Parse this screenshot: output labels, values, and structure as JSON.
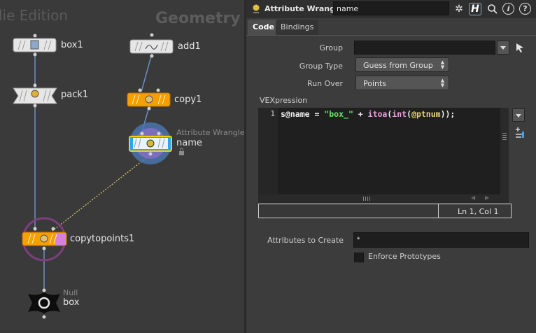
{
  "network": {
    "edition_watermark": "lie Edition",
    "context_title": "Geometry",
    "nodes": {
      "box1": {
        "label": "box1"
      },
      "add1": {
        "label": "add1"
      },
      "pack1": {
        "label": "pack1"
      },
      "copy1": {
        "label": "copy1"
      },
      "wrangle": {
        "type_label": "Attribute Wrangle",
        "label": "name"
      },
      "copytopoints1": {
        "label": "copytopoints1"
      },
      "null": {
        "type_label": "Null",
        "label": "box"
      }
    },
    "colors": {
      "bg": "#3a3a3a",
      "wire": "#6b8fc4",
      "selected_node": "#f5a000",
      "dotted_wire": "#d9d06a"
    }
  },
  "panel": {
    "header": {
      "node_type": "Attribute Wrangle",
      "node_name": "name",
      "icons": [
        "gear-icon",
        "houdini-help-icon",
        "search-icon",
        "info-icon",
        "help-icon"
      ],
      "icon_glyphs": {
        "gear": "✲",
        "h": "H",
        "search": "🔍",
        "info": "i",
        "help": "?"
      }
    },
    "tabs": [
      {
        "label": "Code",
        "active": true
      },
      {
        "label": "Bindings",
        "active": false
      }
    ],
    "parms": {
      "group_label": "Group",
      "group_value": "",
      "group_type_label": "Group Type",
      "group_type_value": "Guess from Group",
      "run_over_label": "Run Over",
      "run_over_value": "Points",
      "vexpression_label": "VEXpression",
      "code_line_number": "1",
      "code": {
        "t1": "s@name",
        "t2": " = ",
        "t3": "\"box_\"",
        "t4": " + ",
        "t5": "itoa",
        "t6": "(",
        "t7": "int",
        "t8": "(",
        "t9": "@ptnum",
        "t10": "));"
      },
      "cursor_status": "Ln 1, Col 1",
      "attributes_to_create_label": "Attributes to Create",
      "attributes_to_create_value": "*",
      "enforce_prototypes_label": "Enforce Prototypes",
      "enforce_prototypes_checked": false
    }
  }
}
